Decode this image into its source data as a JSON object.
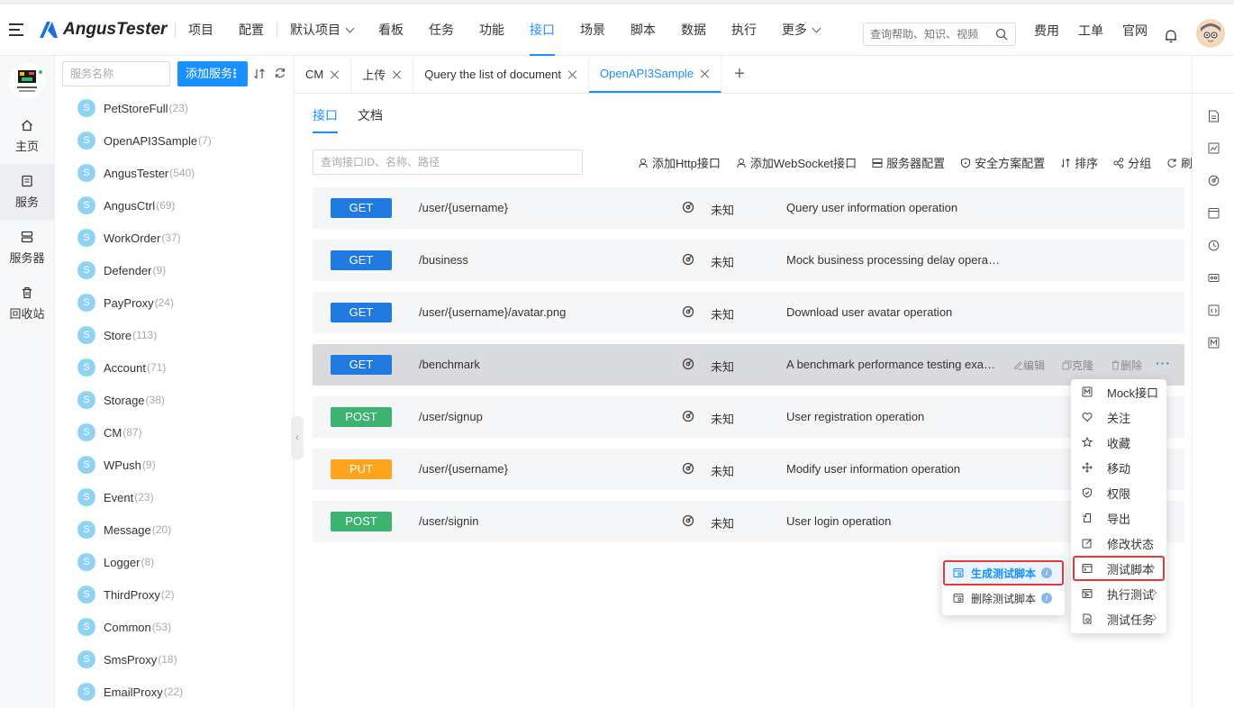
{
  "app": {
    "name": "AngusTester"
  },
  "nav": {
    "items": [
      "项目",
      "配置",
      "默认项目",
      "看板",
      "任务",
      "功能",
      "接口",
      "场景",
      "脚本",
      "数据",
      "执行",
      "更多"
    ],
    "active": "接口"
  },
  "search": {
    "placeholder": "查询帮助、知识、视频"
  },
  "right_nav": [
    "费用",
    "工单",
    "官网"
  ],
  "left_rail": {
    "items": [
      {
        "label": "主页",
        "icon": "home-icon"
      },
      {
        "label": "服务",
        "icon": "document-icon"
      },
      {
        "label": "服务器",
        "icon": "server-icon"
      },
      {
        "label": "回收站",
        "icon": "trash-icon"
      }
    ],
    "active": "服务"
  },
  "service_panel": {
    "search_placeholder": "服务名称",
    "add_button": "添加服务",
    "services": [
      {
        "badge": "S",
        "name": "PetStoreFull",
        "count": "(23)"
      },
      {
        "badge": "S",
        "name": "OpenAPI3Sample",
        "count": "(7)"
      },
      {
        "badge": "S",
        "name": "AngusTester",
        "count": "(540)"
      },
      {
        "badge": "S",
        "name": "AngusCtrl",
        "count": "(69)"
      },
      {
        "badge": "S",
        "name": "WorkOrder",
        "count": "(37)"
      },
      {
        "badge": "S",
        "name": "Defender",
        "count": "(9)"
      },
      {
        "badge": "S",
        "name": "PayProxy",
        "count": "(24)"
      },
      {
        "badge": "S",
        "name": "Store",
        "count": "(113)"
      },
      {
        "badge": "S",
        "name": "Account",
        "count": "(71)"
      },
      {
        "badge": "S",
        "name": "Storage",
        "count": "(38)"
      },
      {
        "badge": "S",
        "name": "CM",
        "count": "(87)"
      },
      {
        "badge": "S",
        "name": "WPush",
        "count": "(9)"
      },
      {
        "badge": "S",
        "name": "Event",
        "count": "(23)"
      },
      {
        "badge": "S",
        "name": "Message",
        "count": "(20)"
      },
      {
        "badge": "S",
        "name": "Logger",
        "count": "(8)"
      },
      {
        "badge": "S",
        "name": "ThirdProxy",
        "count": "(2)"
      },
      {
        "badge": "S",
        "name": "Common",
        "count": "(53)"
      },
      {
        "badge": "S",
        "name": "SmsProxy",
        "count": "(18)"
      },
      {
        "badge": "S",
        "name": "EmailProxy",
        "count": "(22)"
      }
    ]
  },
  "tabs": {
    "items": [
      "CM",
      "上传",
      "Query the list of document",
      "OpenAPI3Sample"
    ],
    "active": "OpenAPI3Sample",
    "add_label": "+"
  },
  "subtabs": {
    "items": [
      "接口",
      "文档"
    ],
    "active": "接口"
  },
  "api_search": {
    "placeholder": "查询接口ID、名称、路径"
  },
  "toolbar": [
    "添加Http接口",
    "添加WebSocket接口",
    "服务器配置",
    "安全方案配置",
    "排序",
    "分组",
    "刷新"
  ],
  "apis": [
    {
      "method": "GET",
      "path": "/user/{username}",
      "status": "未知",
      "desc": "Query user information operation"
    },
    {
      "method": "GET",
      "path": "/business",
      "status": "未知",
      "desc": "Mock business processing delay operation"
    },
    {
      "method": "GET",
      "path": "/user/{username}/avatar.png",
      "status": "未知",
      "desc": "Download user avatar operation"
    },
    {
      "method": "GET",
      "path": "/benchmark",
      "status": "未知",
      "desc": "A benchmark performance testing exampl…",
      "hover": true
    },
    {
      "method": "POST",
      "path": "/user/signup",
      "status": "未知",
      "desc": "User registration operation"
    },
    {
      "method": "PUT",
      "path": "/user/{username}",
      "status": "未知",
      "desc": "Modify user information operation"
    },
    {
      "method": "POST",
      "path": "/user/signin",
      "status": "未知",
      "desc": "User login operation"
    }
  ],
  "row_actions": {
    "edit": "编辑",
    "clone": "克隆",
    "delete": "删除",
    "more": "···"
  },
  "context_menu": {
    "items": [
      "Mock接口",
      "关注",
      "收藏",
      "移动",
      "权限",
      "导出",
      "修改状态",
      "测试脚本",
      "执行测试",
      "测试任务"
    ],
    "highlighted": "测试脚本"
  },
  "submenu": {
    "items": [
      "生成测试脚本",
      "删除测试脚本"
    ],
    "highlighted": "生成测试脚本"
  },
  "colors": {
    "accent": "#1890ff",
    "get": "#1f7be0",
    "post": "#3cb371",
    "put": "#ffa41b",
    "highlight": "#e53935"
  }
}
